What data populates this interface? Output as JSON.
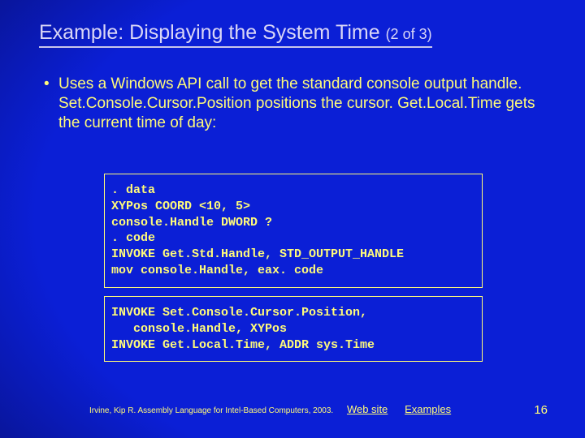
{
  "title": {
    "main": "Example: Displaying the System Time",
    "part": "(2 of 3)"
  },
  "bullet": "Uses a Windows API call to get the standard console output handle. Set.Console.Cursor.Position positions the cursor. Get.Local.Time gets the current time of day:",
  "code1": {
    "l1": ". data",
    "l2": "XYPos COORD <10, 5>",
    "l3": "console.Handle DWORD ?",
    "l4": ". code",
    "l5": "INVOKE Get.Std.Handle, STD_OUTPUT_HANDLE",
    "l6": "mov console.Handle, eax. code"
  },
  "code2": {
    "l1": "INVOKE Set.Console.Cursor.Position,",
    "l2": "   console.Handle, XYPos",
    "l3": "INVOKE Get.Local.Time, ADDR sys.Time"
  },
  "footer": {
    "credit": "Irvine, Kip R. Assembly Language for Intel-Based Computers, 2003.",
    "link1": "Web site",
    "link2": "Examples"
  },
  "page": "16"
}
